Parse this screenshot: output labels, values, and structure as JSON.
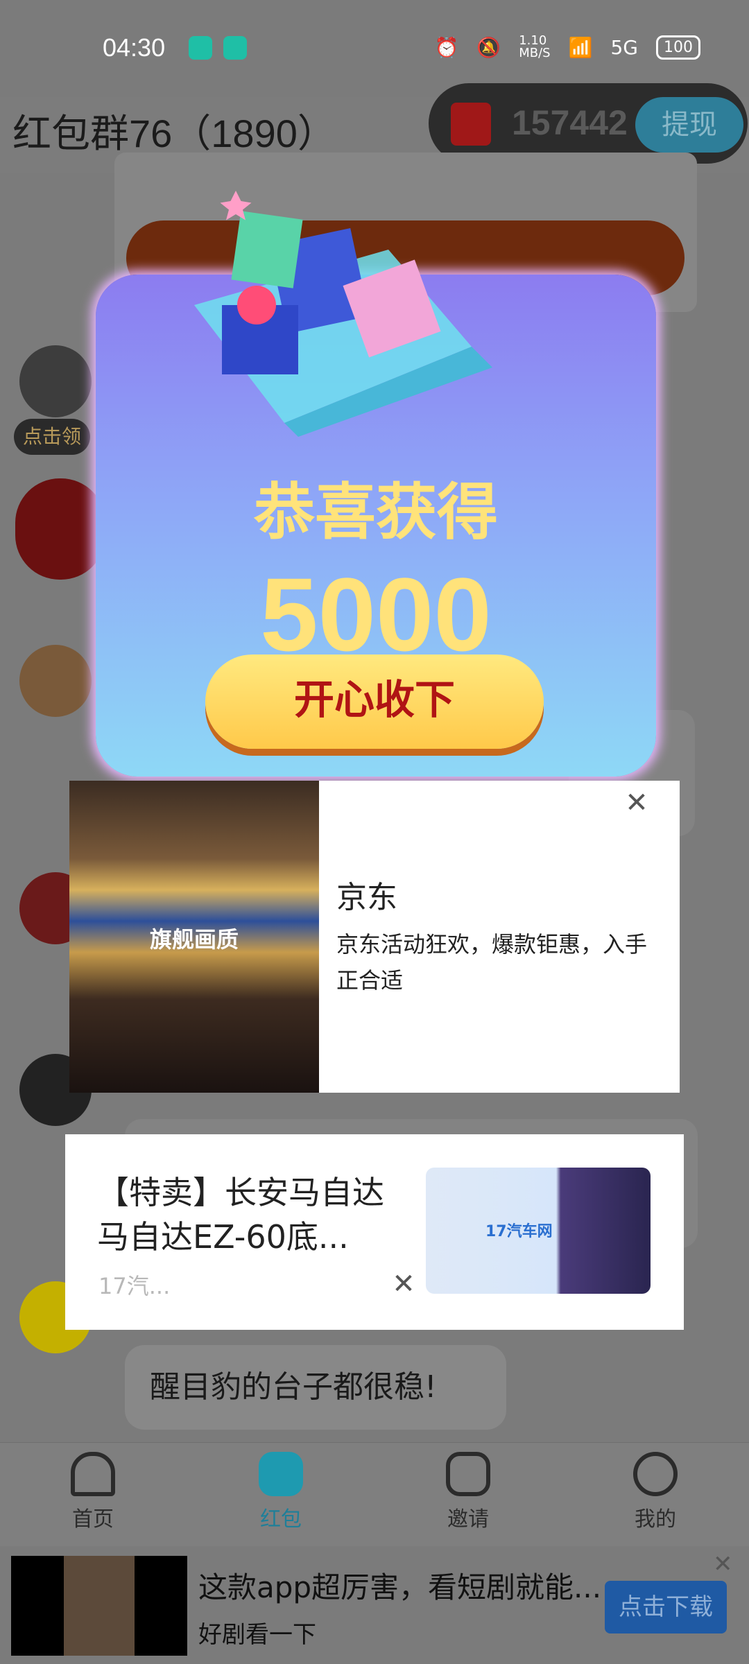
{
  "status_bar": {
    "time": "04:30",
    "speed": "1.10\nMB/S",
    "network": "5G",
    "battery": "100"
  },
  "header": {
    "title": "红包群76（1890）",
    "balance": "157442",
    "withdraw_label": "提现"
  },
  "popup": {
    "congrats": "恭喜获得",
    "amount": "5000",
    "accept_label": "开心收下"
  },
  "ad1": {
    "image_text": "旗舰画质",
    "title": "京东",
    "description": "京东活动狂欢，爆款钜惠，入手正合适"
  },
  "ad2": {
    "title": "【特卖】长安马自达 马自达EZ-60底...",
    "source": "17汽...",
    "image_logo": "17汽车网"
  },
  "chat": {
    "last_message": "醒目豹的台子都很稳!",
    "claim_tag": "点击领"
  },
  "nav": {
    "items": [
      {
        "label": "首页",
        "icon": "home-icon"
      },
      {
        "label": "红包",
        "icon": "red-packet-icon"
      },
      {
        "label": "邀请",
        "icon": "invite-icon"
      },
      {
        "label": "我的",
        "icon": "profile-icon"
      }
    ]
  },
  "bottom_ad": {
    "title": "这款app超厉害，看短剧就能...",
    "subtitle": "好剧看一下",
    "button_label": "点击下载"
  },
  "colors": {
    "popup_gradient_top": "#8c7cf0",
    "popup_gradient_bottom": "#8ed8f6",
    "gold": "#ffe37a",
    "accept_button": "#ffd05a"
  }
}
